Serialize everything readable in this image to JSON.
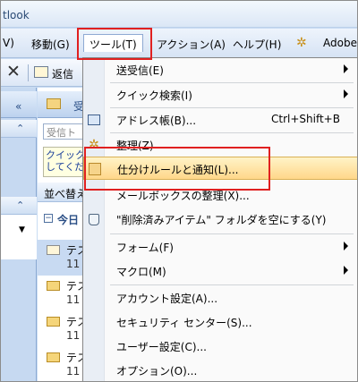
{
  "window": {
    "title_fragment": "tlook"
  },
  "menubar": {
    "items": [
      {
        "label": "V)"
      },
      {
        "label": "移動(G)"
      },
      {
        "label": "ツール(T)"
      },
      {
        "label": "アクション(A)"
      },
      {
        "label": "ヘルプ(H)"
      },
      {
        "label": "Adobe"
      }
    ]
  },
  "toolbar": {
    "reply_label": "返信"
  },
  "nav": {
    "chevron": "«",
    "section_chevron": "⌃"
  },
  "mail": {
    "folder_initial": "受",
    "search_placeholder": "受信ト",
    "hint_line1": "クイック",
    "hint_line2": "してくだ",
    "sort_label": "並べ替え",
    "group_label": "今日",
    "rows": [
      {
        "subject": "テス",
        "num": "11"
      },
      {
        "subject": "テス",
        "num": "11"
      },
      {
        "subject": "テス",
        "num": "11"
      },
      {
        "subject": "テス",
        "num": "11"
      }
    ]
  },
  "tools_menu": {
    "items": [
      {
        "label": "送受信(E)"
      },
      {
        "label": "クイック検索(I)"
      },
      {
        "label": "アドレス帳(B)...",
        "shortcut": "Ctrl+Shift+B"
      },
      {
        "label": "整理(Z)"
      },
      {
        "label": "仕分けルールと通知(L)..."
      },
      {
        "label": "メールボックスの整理(X)..."
      },
      {
        "label": "\"削除済みアイテム\" フォルダを空にする(Y)"
      },
      {
        "label": "フォーム(F)"
      },
      {
        "label": "マクロ(M)"
      },
      {
        "label": "アカウント設定(A)..."
      },
      {
        "label": "セキュリティ センター(S)..."
      },
      {
        "label": "ユーザー設定(C)..."
      },
      {
        "label": "オプション(O)..."
      }
    ]
  },
  "colors": {
    "highlight_box": "#e02020",
    "menu_hover": "#ffd78a"
  }
}
